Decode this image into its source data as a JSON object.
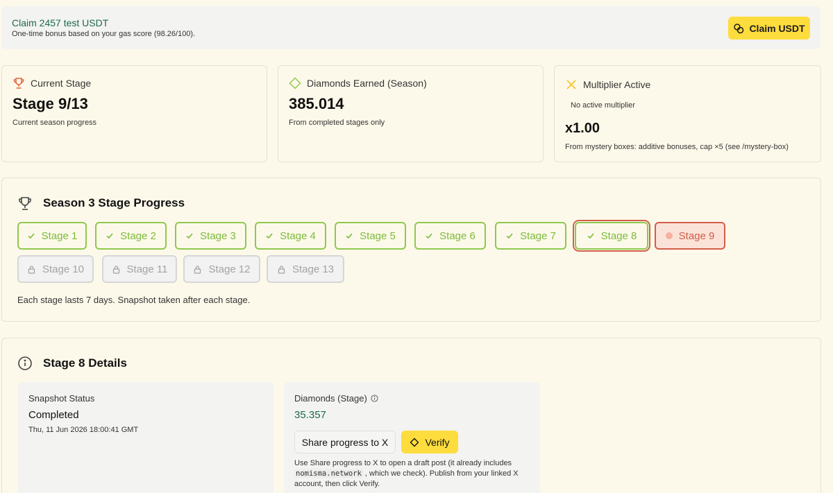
{
  "claim": {
    "title": "Claim 2457 test USDT",
    "subtitle": "One-time bonus based on your gas score (98.26/100).",
    "button_label": "Claim USDT",
    "button_icon": "coins-icon"
  },
  "stats": {
    "current_stage": {
      "label": "Current Stage",
      "value": "Stage 9/13",
      "sub": "Current season progress",
      "icon": "trophy-icon"
    },
    "diamonds": {
      "label": "Diamonds Earned (Season)",
      "value": "385.014",
      "sub": "From completed stages only",
      "icon": "diamond-icon"
    },
    "multiplier": {
      "label": "Multiplier Active",
      "status": "No active multiplier",
      "value": "x1.00",
      "sub": "From mystery boxes: additive bonuses, cap ×5 (see /mystery-box)",
      "icon": "x-icon"
    }
  },
  "progress": {
    "title": "Season 3 Stage Progress",
    "stages": [
      {
        "label": "Stage 1",
        "state": "done"
      },
      {
        "label": "Stage 2",
        "state": "done"
      },
      {
        "label": "Stage 3",
        "state": "done"
      },
      {
        "label": "Stage 4",
        "state": "done"
      },
      {
        "label": "Stage 5",
        "state": "done"
      },
      {
        "label": "Stage 6",
        "state": "done"
      },
      {
        "label": "Stage 7",
        "state": "done"
      },
      {
        "label": "Stage 8",
        "state": "done-selected"
      },
      {
        "label": "Stage 9",
        "state": "active"
      },
      {
        "label": "Stage 10",
        "state": "locked"
      },
      {
        "label": "Stage 11",
        "state": "locked"
      },
      {
        "label": "Stage 12",
        "state": "locked"
      },
      {
        "label": "Stage 13",
        "state": "locked"
      }
    ],
    "note": "Each stage lasts 7 days. Snapshot taken after each stage."
  },
  "details": {
    "title": "Stage 8 Details",
    "snapshot": {
      "label": "Snapshot Status",
      "value": "Completed",
      "timestamp": "Thu, 11 Jun 2026 18:00:41 GMT"
    },
    "diamonds": {
      "label": "Diamonds (Stage)",
      "value": "35.357",
      "share_label": "Share progress to X",
      "verify_label": "Verify",
      "help_before": "Use Share progress to X to open a draft post (it already includes",
      "help_code": "nomisma.network",
      "help_after": ", which we check). Publish from your linked X account, then click Verify."
    }
  },
  "colors": {
    "background": "#fdf9ea",
    "accent_yellow": "#fddc3d",
    "done_green": "#7bbb3a",
    "active_red": "#d25d48",
    "value_green": "#1c6b48"
  }
}
